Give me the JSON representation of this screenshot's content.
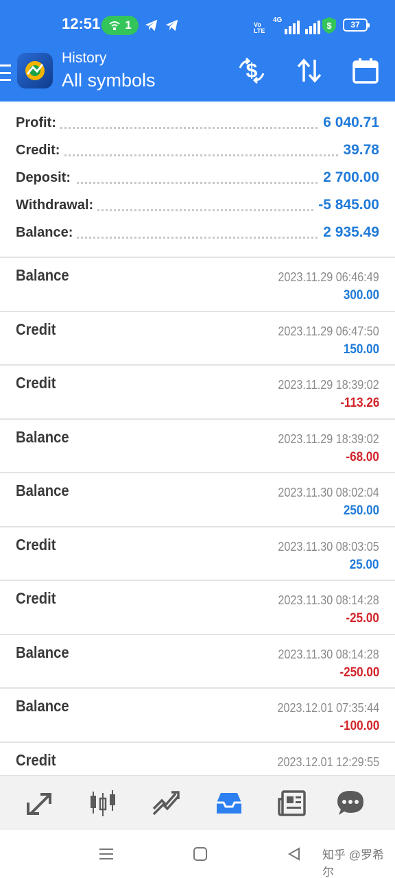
{
  "status_bar": {
    "time": "12:51",
    "hotspot_count": "1",
    "network_type": "4G",
    "volte_label": "Vo LTE",
    "battery_level": "37"
  },
  "app_bar": {
    "subtitle": "History",
    "title": "All symbols",
    "actions": [
      "money-exchange-icon",
      "sort-icon",
      "calendar-icon"
    ]
  },
  "summary": [
    {
      "label": "Profit:",
      "value": "6 040.71"
    },
    {
      "label": "Credit:",
      "value": "39.78"
    },
    {
      "label": "Deposit:",
      "value": "2 700.00"
    },
    {
      "label": "Withdrawal:",
      "value": "-5 845.00"
    },
    {
      "label": "Balance:",
      "value": "2 935.49"
    }
  ],
  "deals": [
    {
      "type": "Balance",
      "time": "2023.11.29 06:46:49",
      "amount": "300.00",
      "positive": true
    },
    {
      "type": "Credit",
      "time": "2023.11.29 06:47:50",
      "amount": "150.00",
      "positive": true
    },
    {
      "type": "Credit",
      "time": "2023.11.29 18:39:02",
      "amount": "-113.26",
      "positive": false
    },
    {
      "type": "Balance",
      "time": "2023.11.29 18:39:02",
      "amount": "-68.00",
      "positive": false
    },
    {
      "type": "Balance",
      "time": "2023.11.30 08:02:04",
      "amount": "250.00",
      "positive": true
    },
    {
      "type": "Credit",
      "time": "2023.11.30 08:03:05",
      "amount": "25.00",
      "positive": true
    },
    {
      "type": "Credit",
      "time": "2023.11.30 08:14:28",
      "amount": "-25.00",
      "positive": false
    },
    {
      "type": "Balance",
      "time": "2023.11.30 08:14:28",
      "amount": "-250.00",
      "positive": false
    },
    {
      "type": "Balance",
      "time": "2023.12.01 07:35:44",
      "amount": "-100.00",
      "positive": false
    },
    {
      "type": "Credit",
      "time": "2023.12.01 12:29:55",
      "amount": "",
      "positive": false
    }
  ],
  "bottom_nav": {
    "items": [
      "quotes-icon",
      "chart-icon",
      "trade-icon",
      "history-icon",
      "news-icon",
      "chat-icon"
    ],
    "active": "history-icon"
  },
  "system_nav": {
    "buttons": [
      "menu-icon",
      "home-icon",
      "back-icon"
    ],
    "watermark": "知乎 @罗希尔"
  },
  "colors": {
    "header_blue": "#2e7ff0",
    "positive_blue": "#1f7ad8",
    "negative_red": "#d2232a"
  }
}
